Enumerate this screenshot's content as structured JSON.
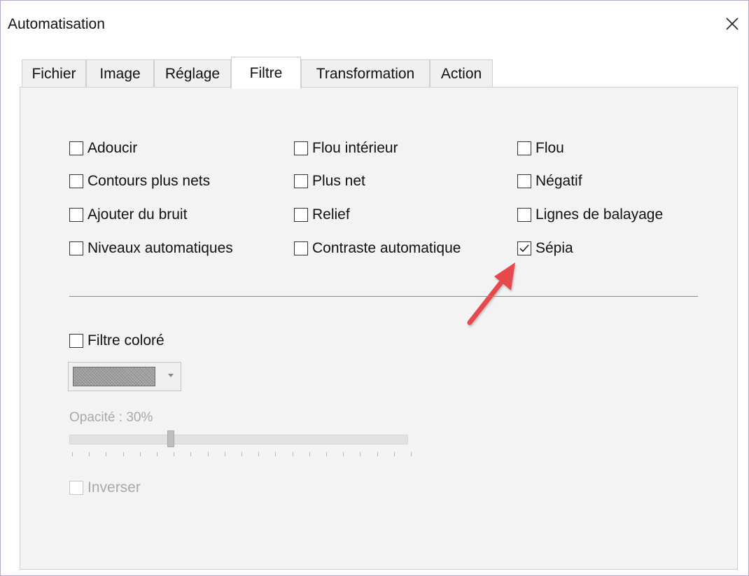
{
  "window": {
    "title": "Automatisation"
  },
  "tabs": [
    {
      "label": "Fichier",
      "active": false
    },
    {
      "label": "Image",
      "active": false
    },
    {
      "label": "Réglage",
      "active": false
    },
    {
      "label": "Filtre",
      "active": true
    },
    {
      "label": "Transformation",
      "active": false
    },
    {
      "label": "Action",
      "active": false
    }
  ],
  "filters": {
    "col1": [
      {
        "label": "Adoucir",
        "checked": false
      },
      {
        "label": "Contours plus nets",
        "checked": false
      },
      {
        "label": "Ajouter du bruit",
        "checked": false
      },
      {
        "label": "Niveaux automatiques",
        "checked": false
      }
    ],
    "col2": [
      {
        "label": "Flou intérieur",
        "checked": false
      },
      {
        "label": "Plus net",
        "checked": false
      },
      {
        "label": "Relief",
        "checked": false
      },
      {
        "label": "Contraste automatique",
        "checked": false
      }
    ],
    "col3": [
      {
        "label": "Flou",
        "checked": false
      },
      {
        "label": "Négatif",
        "checked": false
      },
      {
        "label": "Lignes de balayage",
        "checked": false
      },
      {
        "label": "Sépia",
        "checked": true
      }
    ]
  },
  "color_filter": {
    "label": "Filtre coloré",
    "checked": false,
    "swatch_color": "#a0a0a0"
  },
  "opacity": {
    "label": "Opacité : 30%",
    "value": 30,
    "min": 0,
    "max": 100,
    "tick_count": 21
  },
  "invert": {
    "label": "Inverser",
    "checked": false,
    "disabled": true
  },
  "annotation": {
    "arrow_color": "#e5484d"
  }
}
